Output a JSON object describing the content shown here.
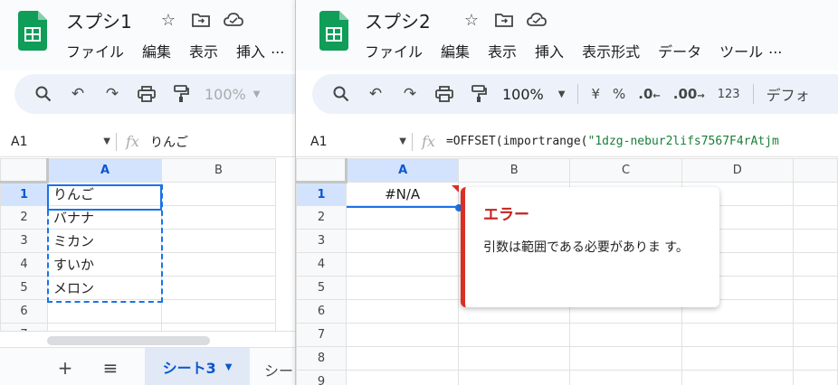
{
  "win1": {
    "title": "スプシ1",
    "menu": [
      "ファイル",
      "編集",
      "表示",
      "挿入",
      "..."
    ],
    "toolbar": {
      "zoom": "100%"
    },
    "formula": {
      "namebox": "A1",
      "content": "りんご"
    },
    "columns": [
      "A",
      "B"
    ],
    "rows": [
      "1",
      "2",
      "3",
      "4",
      "5",
      "6",
      "7"
    ],
    "cells": [
      "りんご",
      "バナナ",
      "ミカン",
      "すいか",
      "メロン",
      "",
      ""
    ],
    "sheet_active": "シート3",
    "sheet_next": "シー"
  },
  "win2": {
    "title": "スプシ2",
    "menu": [
      "ファイル",
      "編集",
      "表示",
      "挿入",
      "表示形式",
      "データ",
      "ツール",
      "..."
    ],
    "toolbar": {
      "zoom": "100%",
      "currency": "¥",
      "percent": "%",
      "dec_less": ".0",
      "dec_more": ".00",
      "num123": "123",
      "font": "デフォ"
    },
    "formula": {
      "namebox": "A1",
      "prefix": "=OFFSET(importrange(",
      "string": "\"1dzg-nebur2lifs7567F4rAtjm"
    },
    "columns": [
      "A",
      "B",
      "C",
      "D"
    ],
    "rows": [
      "1",
      "2",
      "3",
      "4",
      "5",
      "6",
      "7",
      "8",
      "9"
    ],
    "a1": "#N/A",
    "error": {
      "title": "エラー",
      "message": "引数は範囲である必要がありま す。"
    }
  },
  "colors": {
    "brand_green": "#0f9d58",
    "selection": "#1a73e8",
    "error_red": "#d93025"
  }
}
